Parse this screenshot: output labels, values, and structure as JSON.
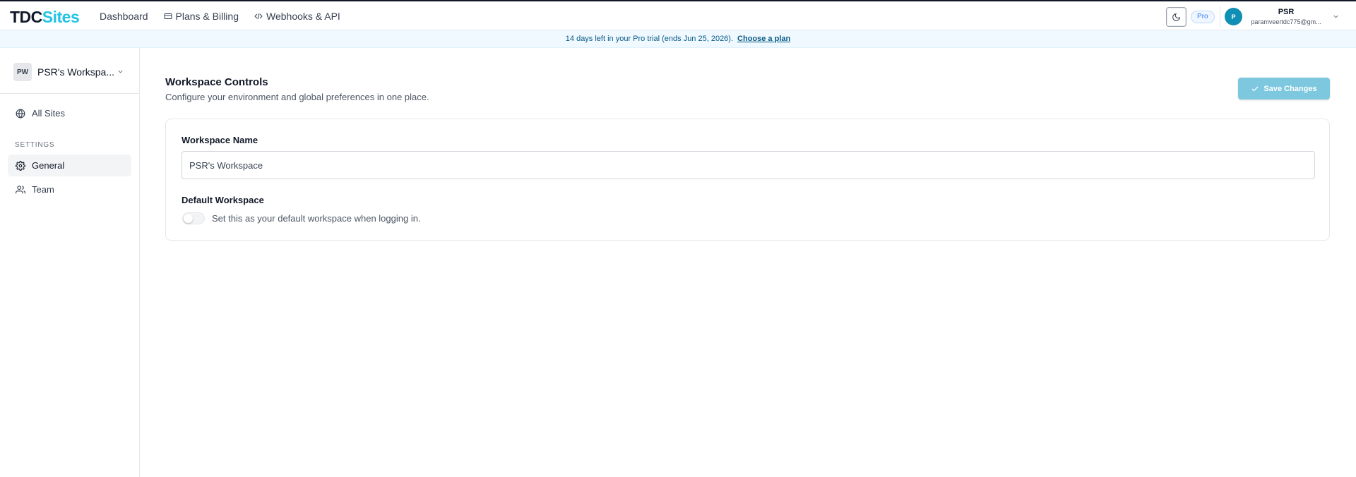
{
  "header": {
    "logo_part1": "TDC",
    "logo_part2": "Sites",
    "nav": [
      {
        "label": "Dashboard"
      },
      {
        "label": "Plans & Billing"
      },
      {
        "label": "Webhooks & API"
      }
    ],
    "plan_badge": "Pro",
    "user": {
      "initial": "P",
      "name": "PSR",
      "email": "paramveertdc775@gm..."
    }
  },
  "banner": {
    "message": "14 days left in your Pro trial (ends Jun 25, 2026).",
    "cta": "Choose a plan"
  },
  "sidebar": {
    "workspace_initials": "PW",
    "workspace_name": "PSR's Workspa...",
    "all_sites": "All Sites",
    "section_label": "SETTINGS",
    "items": [
      {
        "label": "General",
        "active": true
      },
      {
        "label": "Team",
        "active": false
      }
    ]
  },
  "main": {
    "title": "Workspace Controls",
    "subtitle": "Configure your environment and global preferences in one place.",
    "save_label": "Save Changes",
    "workspace_name_label": "Workspace Name",
    "workspace_name_value": "PSR's Workspace",
    "default_label": "Default Workspace",
    "default_desc": "Set this as your default workspace when logging in.",
    "default_enabled": false
  },
  "colors": {
    "brand_accent": "#22c3e6",
    "avatar_bg": "#0e8fb3",
    "save_button_bg": "#7ec8df",
    "banner_bg": "#f0f9ff"
  }
}
